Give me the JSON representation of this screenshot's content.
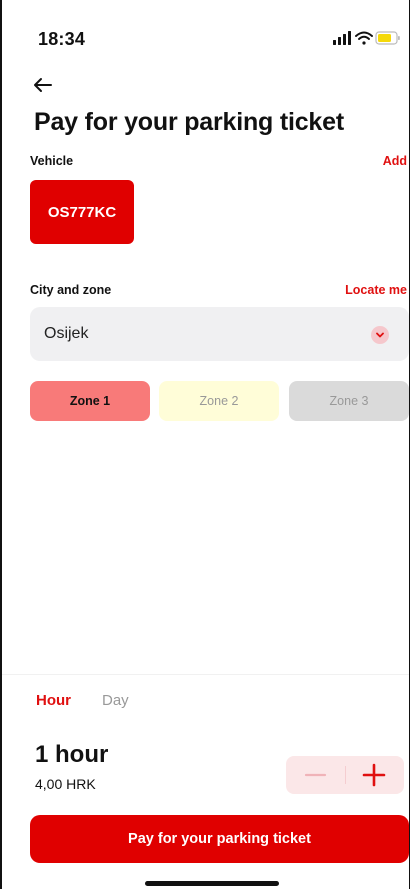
{
  "status_bar": {
    "time": "18:34",
    "icons": [
      "signal-icon",
      "wifi-icon",
      "battery-icon"
    ],
    "battery_color": "#f5d90a"
  },
  "header": {
    "back_icon": "arrow-left-icon",
    "title": "Pay for your parking ticket"
  },
  "vehicle": {
    "label": "Vehicle",
    "add_label": "Add",
    "plate": "OS777KC"
  },
  "city_zone": {
    "label": "City and zone",
    "locate_label": "Locate me",
    "selected_city": "Osijek",
    "chevron_icon": "chevron-down-icon",
    "zones": [
      {
        "label": "Zone 1",
        "color": "#f87a79",
        "selected": true
      },
      {
        "label": "Zone 2",
        "color": "#fffdd8",
        "selected": false
      },
      {
        "label": "Zone 3",
        "color": "#dadada",
        "selected": false
      }
    ]
  },
  "duration": {
    "tabs": [
      {
        "label": "Hour",
        "active": true
      },
      {
        "label": "Day",
        "active": false
      }
    ],
    "value_label": "1 hour",
    "price": "4,00 HRK",
    "decrement_icon": "minus-icon",
    "increment_icon": "plus-icon"
  },
  "pay_button_label": "Pay for your parking ticket",
  "colors": {
    "accent": "#e00000",
    "link": "#e01010",
    "stepper_bg": "#fbe7e8",
    "select_bg": "#f0f0f2"
  }
}
